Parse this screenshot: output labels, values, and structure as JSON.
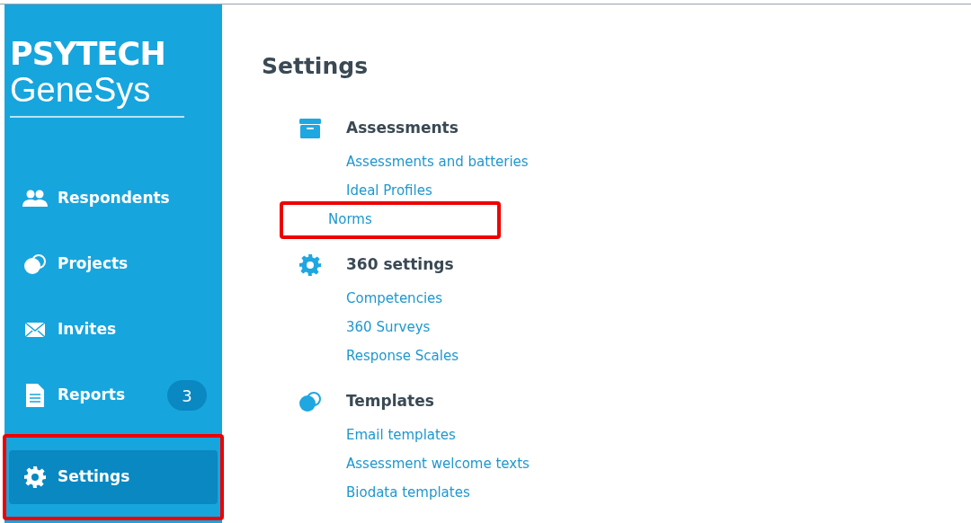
{
  "logo": {
    "line_1": "PSYTECH",
    "line_2": "GeneSys"
  },
  "nav": [
    {
      "kind": "people",
      "label": "Respondents",
      "selected": false,
      "highlighted": false
    },
    {
      "kind": "bubbles",
      "label": "Projects",
      "selected": false,
      "highlighted": false
    },
    {
      "kind": "envelope",
      "label": "Invites",
      "selected": false,
      "highlighted": false
    },
    {
      "kind": "document",
      "label": "Reports",
      "badge": "3",
      "selected": false,
      "highlighted": false
    },
    {
      "kind": "gear",
      "label": "Settings",
      "selected": true,
      "highlighted": true
    }
  ],
  "page_title": "Settings",
  "sections": [
    {
      "kind": "box",
      "heading": "Assessments",
      "links": [
        {
          "label": "Assessments and batteries",
          "highlighted": false
        },
        {
          "label": "Ideal Profiles",
          "highlighted": false
        },
        {
          "label": "Norms",
          "highlighted": true
        }
      ]
    },
    {
      "kind": "gear",
      "heading": "360 settings",
      "links": [
        {
          "label": "Competencies",
          "highlighted": false
        },
        {
          "label": "360 Surveys",
          "highlighted": false
        },
        {
          "label": "Response Scales",
          "highlighted": false
        }
      ]
    },
    {
      "kind": "bubbles",
      "heading": "Templates",
      "links": [
        {
          "label": "Email templates",
          "highlighted": false
        },
        {
          "label": "Assessment welcome texts",
          "highlighted": false
        },
        {
          "label": "Biodata templates",
          "highlighted": false
        }
      ]
    }
  ]
}
